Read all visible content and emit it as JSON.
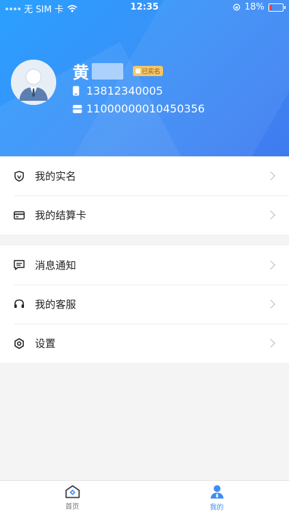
{
  "status_bar": {
    "carrier": "无 SIM 卡",
    "time": "12:35",
    "battery_percent": "18%",
    "battery_level": 0.18
  },
  "profile": {
    "name": "黄",
    "verified_badge": "已实名",
    "phone": "13812340005",
    "card_number": "11000000010450356"
  },
  "menu_group_1": [
    {
      "label": "我的实名",
      "icon": "shield-icon"
    },
    {
      "label": "我的结算卡",
      "icon": "card-icon"
    }
  ],
  "menu_group_2": [
    {
      "label": "消息通知",
      "icon": "message-icon"
    },
    {
      "label": "我的客服",
      "icon": "headset-icon"
    },
    {
      "label": "设置",
      "icon": "settings-icon"
    }
  ],
  "tabbar": {
    "home_label": "首页",
    "mine_label": "我的",
    "active": "mine"
  },
  "colors": {
    "accent": "#3d8ef6",
    "badge": "#f4c56a"
  }
}
